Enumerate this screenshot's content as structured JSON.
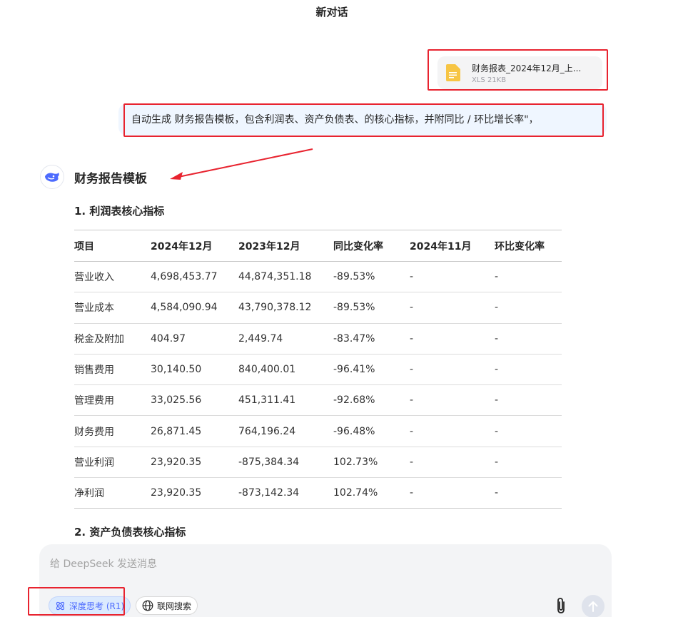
{
  "header": {
    "title": "新对话"
  },
  "attachment": {
    "file_name": "财务报表_2024年12月_上...",
    "file_meta": "XLS 21KB"
  },
  "user_message": "自动生成 财务报告模板，包含利润表、资产负债表、的核心指标，并附同比 / 环比增长率\"，",
  "response": {
    "title": "财务报告模板",
    "section1_heading": "1. 利润表核心指标",
    "section2_heading": "2. 资产负债表核心指标",
    "table": {
      "headers": [
        "项目",
        "2024年12月",
        "2023年12月",
        "同比变化率",
        "2024年11月",
        "环比变化率"
      ],
      "rows": [
        [
          "营业收入",
          "4,698,453.77",
          "44,874,351.18",
          "-89.53%",
          "-",
          "-"
        ],
        [
          "营业成本",
          "4,584,090.94",
          "43,790,378.12",
          "-89.53%",
          "-",
          "-"
        ],
        [
          "税金及附加",
          "404.97",
          "2,449.74",
          "-83.47%",
          "-",
          "-"
        ],
        [
          "销售费用",
          "30,140.50",
          "840,400.01",
          "-96.41%",
          "-",
          "-"
        ],
        [
          "管理费用",
          "33,025.56",
          "451,311.41",
          "-92.68%",
          "-",
          "-"
        ],
        [
          "财务费用",
          "26,871.45",
          "764,196.24",
          "-96.48%",
          "-",
          "-"
        ],
        [
          "营业利润",
          "23,920.35",
          "-875,384.34",
          "102.73%",
          "-",
          "-"
        ],
        [
          "净利润",
          "23,920.35",
          "-873,142.34",
          "102.74%",
          "-",
          "-"
        ]
      ]
    }
  },
  "composer": {
    "placeholder": "给 DeepSeek 发送消息",
    "deep_think_label": "深度思考 (R1)",
    "web_search_label": "联网搜索"
  },
  "colors": {
    "accent": "#4d6bfe",
    "annotation_red": "#e8232f",
    "file_icon": "#f7c544"
  },
  "icons": [
    "file-icon",
    "deepseek-whale-icon",
    "atom-icon",
    "globe-icon",
    "paperclip-icon",
    "arrow-up-icon"
  ]
}
